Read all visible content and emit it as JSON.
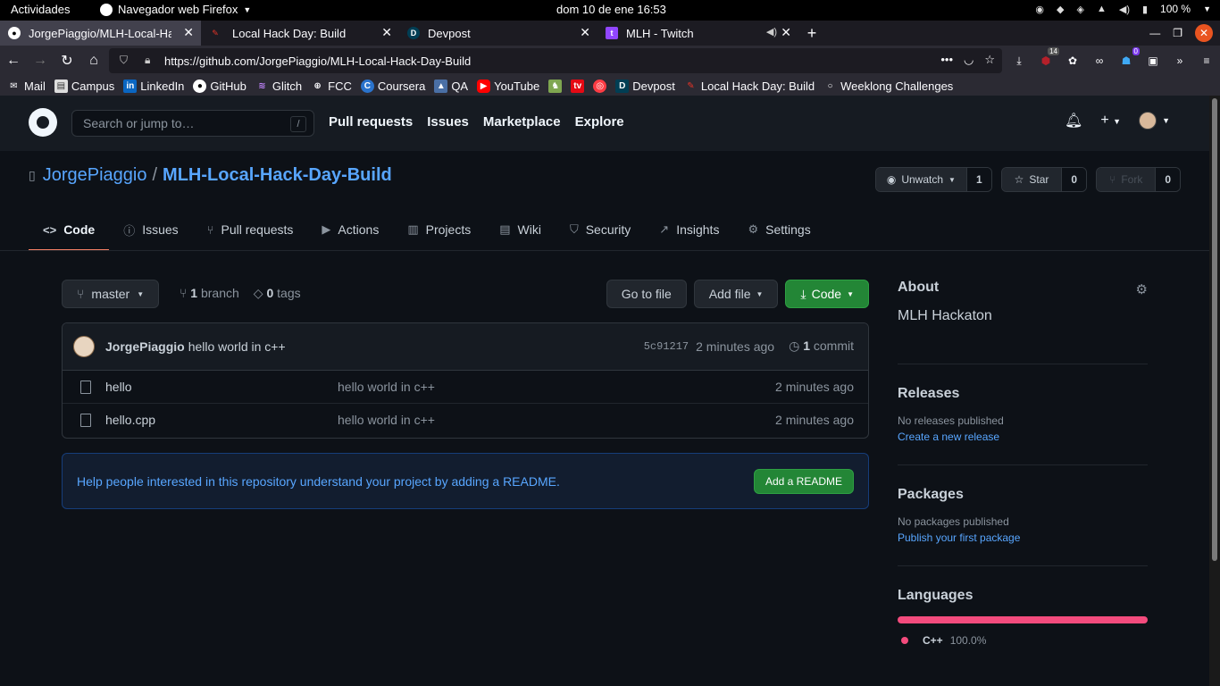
{
  "os": {
    "activities": "Actividades",
    "app_name": "Navegador web Firefox",
    "clock": "dom 10 de ene  16:53",
    "battery": "100 %"
  },
  "tabs": [
    {
      "title": "JorgePiaggio/MLH-Local-Hack-Day-Build",
      "active": true
    },
    {
      "title": "Local Hack Day: Build",
      "active": false
    },
    {
      "title": "Devpost",
      "active": false
    },
    {
      "title": "MLH - Twitch",
      "active": false
    }
  ],
  "nav": {
    "url": "https://github.com/JorgePiaggio/MLH-Local-Hack-Day-Build",
    "ext_badge_1": "14",
    "ext_badge_2": "0"
  },
  "bookmarks": [
    {
      "label": "Mail",
      "icon": "mail-icon"
    },
    {
      "label": "Campus",
      "icon": "campus-icon"
    },
    {
      "label": "LinkedIn",
      "icon": "linkedin-icon"
    },
    {
      "label": "GitHub",
      "icon": "github-icon"
    },
    {
      "label": "Glitch",
      "icon": "glitch-icon"
    },
    {
      "label": "FCC",
      "icon": "globe-icon"
    },
    {
      "label": "Coursera",
      "icon": "coursera-icon"
    },
    {
      "label": "QA",
      "icon": "qa-icon"
    },
    {
      "label": "YouTube",
      "icon": "youtube-icon"
    },
    {
      "label": "",
      "icon": "chess-icon"
    },
    {
      "label": "",
      "icon": "tv-icon"
    },
    {
      "label": "",
      "icon": "music-icon"
    },
    {
      "label": "Devpost",
      "icon": "devpost-icon"
    },
    {
      "label": "Local Hack Day: Build",
      "icon": "mlh-icon"
    },
    {
      "label": "Weeklong Challenges",
      "icon": "globe-icon"
    }
  ],
  "gh": {
    "search_placeholder": "Search or jump to…",
    "search_key": "/",
    "nav": [
      "Pull requests",
      "Issues",
      "Marketplace",
      "Explore"
    ]
  },
  "repo": {
    "owner": "JorgePiaggio",
    "sep": "/",
    "name": "MLH-Local-Hack-Day-Build",
    "unwatch_label": "Unwatch",
    "watch_count": "1",
    "star_label": "Star",
    "star_count": "0",
    "fork_label": "Fork",
    "fork_count": "0",
    "tabs": [
      {
        "label": "Code",
        "icon": "<>"
      },
      {
        "label": "Issues",
        "icon": "ⓘ"
      },
      {
        "label": "Pull requests",
        "icon": "⑂"
      },
      {
        "label": "Actions",
        "icon": "▶"
      },
      {
        "label": "Projects",
        "icon": "▥"
      },
      {
        "label": "Wiki",
        "icon": "▤"
      },
      {
        "label": "Security",
        "icon": "⛉"
      },
      {
        "label": "Insights",
        "icon": "↗"
      },
      {
        "label": "Settings",
        "icon": "⚙"
      }
    ]
  },
  "toolbar": {
    "branch": "master",
    "branch_count": "1",
    "branch_word": "branch",
    "tag_count": "0",
    "tag_word": "tags",
    "goto_file": "Go to file",
    "add_file": "Add file",
    "code": "Code"
  },
  "commit": {
    "author": "JorgePiaggio",
    "message": "hello world in c++",
    "sha": "5c91217",
    "age": "2 minutes ago",
    "count": "1",
    "count_word": "commit"
  },
  "files": [
    {
      "name": "hello",
      "message": "hello world in c++",
      "age": "2 minutes ago"
    },
    {
      "name": "hello.cpp",
      "message": "hello world in c++",
      "age": "2 minutes ago"
    }
  ],
  "readme": {
    "text": "Help people interested in this repository understand your project by adding a README.",
    "button": "Add a README"
  },
  "sidebar": {
    "about_title": "About",
    "about_desc": "MLH Hackaton",
    "releases_title": "Releases",
    "releases_none": "No releases published",
    "releases_link": "Create a new release",
    "packages_title": "Packages",
    "packages_none": "No packages published",
    "packages_link": "Publish your first package",
    "languages_title": "Languages",
    "lang_name": "C++",
    "lang_pct": "100.0%"
  },
  "colors": {
    "accent_green": "#238636",
    "link_blue": "#58a6ff",
    "cpp_lang": "#f34b7d",
    "active_tab_underline": "#f78166"
  }
}
